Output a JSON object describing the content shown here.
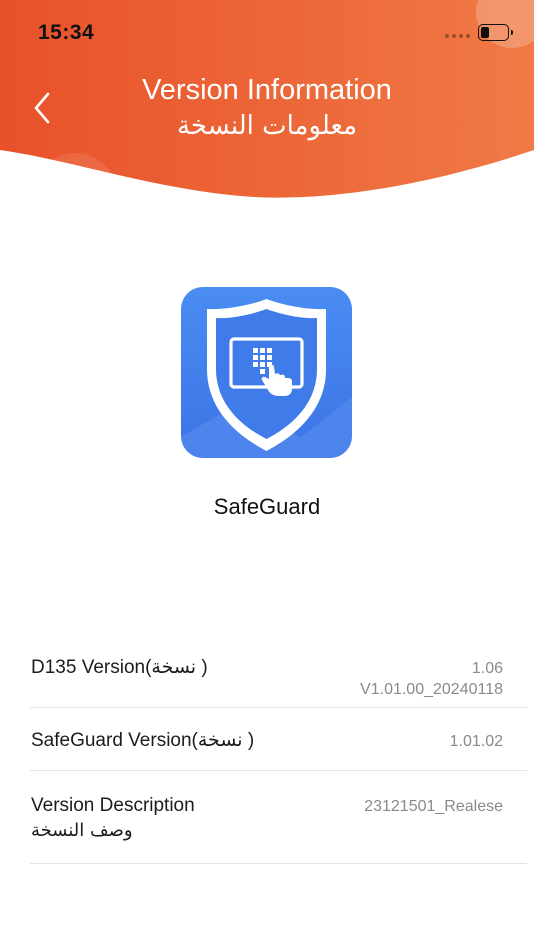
{
  "status_bar": {
    "time": "15:34"
  },
  "header": {
    "title_en": "Version Information",
    "title_ar": "معلومات النسخة",
    "gradient_start": "#e8512a",
    "gradient_end": "#f07a45"
  },
  "app": {
    "name": "SafeGuard",
    "icon": "shield-keypad-icon",
    "icon_color": "#4a84ef"
  },
  "info_rows": [
    {
      "label": "D135 Version(نسخة )",
      "sub": "",
      "value_line1": "1.06",
      "value_line2": "V1.01.00_20240118"
    },
    {
      "label": "SafeGuard Version(نسخة )",
      "sub": "",
      "value_line1": "1.01.02",
      "value_line2": ""
    },
    {
      "label": "Version Description",
      "sub": "وصف النسخة",
      "value_line1": "23121501_Realese",
      "value_line2": ""
    }
  ]
}
